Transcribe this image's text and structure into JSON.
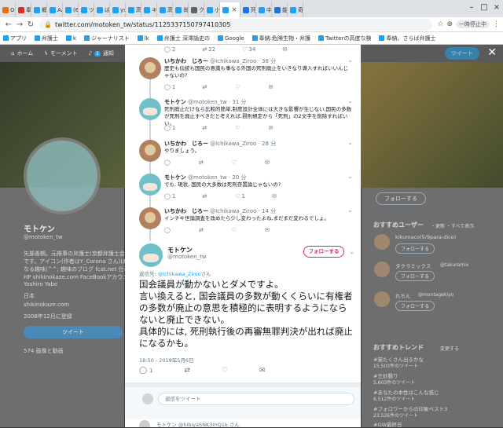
{
  "browser": {
    "tabs": [
      {
        "label": "Or",
        "color": "#e8710a"
      },
      {
        "label": "奉",
        "color": "#d93025"
      },
      {
        "label": "郷",
        "color": "#1da1f2"
      },
      {
        "label": "AA",
        "color": "#1da1f2"
      },
      {
        "label": "(6)",
        "color": "#1da1f2"
      },
      {
        "label": "ツ",
        "color": "#1da1f2"
      },
      {
        "label": "ば",
        "color": "#1da1f2"
      },
      {
        "label": "ys",
        "color": "#1da1f2"
      },
      {
        "label": "高",
        "color": "#1da1f2"
      },
      {
        "label": "キ",
        "color": "#1da1f2"
      },
      {
        "label": "高",
        "color": "#1da1f2"
      },
      {
        "label": "尚",
        "color": "#1da1f2"
      },
      {
        "label": "ク",
        "color": "#5f6368"
      },
      {
        "label": "小",
        "color": "#1da1f2"
      },
      {
        "label": "",
        "color": "#1da1f2",
        "active": true
      },
      {
        "label": "死",
        "color": "#1a73e8"
      },
      {
        "label": "中",
        "color": "#1da1f2"
      },
      {
        "label": "能",
        "color": "#1a73e8"
      },
      {
        "label": "奇",
        "color": "#1da1f2"
      }
    ],
    "window_label": "一時停止中",
    "url": "twitter.com/motoken_tw/status/1125337150797410305",
    "bookmarks": [
      "アプリ",
      "弁護士",
      "k",
      "ジャーナリスト",
      "lk",
      "弁護士 深澤諭史の",
      "Google",
      "奉納:危険生物・弁護",
      "Twitterの高度な検",
      "奉納、さらば弁護士"
    ]
  },
  "twitter_nav": {
    "home": "ホーム",
    "moments": "モーメント",
    "notifications": "通知",
    "notif_count": "1",
    "tweet_button": "ツイート"
  },
  "profile_bg": {
    "name": "モトケン",
    "handle": "@motoken_tw",
    "bio_lines": [
      "矢部善朗。元検事の弁護士(京都弁護士会)",
      "です。アイコン(作者はY_Corona さん)は単",
      "なる趣味(^^; 趣味のブログ fcat.net 仕事用",
      "HP shikinokaze.com FaceBookアカウント",
      "Yoshiro Yabe"
    ],
    "location": "日本",
    "site": "shikinokaze.com",
    "joined": "2008年12月に登録",
    "tweet_button": "ツイート",
    "media_label": "574 画像と動画"
  },
  "right_bg": {
    "follow_label": "フォローする",
    "recommend_title": "おすすめユーザー",
    "recommend_links": "・更新 ・すべて表示",
    "users": [
      {
        "name": "kikumaco(5/9para-dice)"
      },
      {
        "name": "タクラミックス",
        "handle": "@takuramix"
      },
      {
        "name": "れちん",
        "handle": "@montagekiyo"
      }
    ],
    "small_follow": "フォローする",
    "trends_title": "おすすめトレンド",
    "trends_change": "変更する",
    "trends": [
      {
        "tag": "#猫たくさん出るかな",
        "count": "15,503件のツイート"
      },
      {
        "tag": "#王妙腸り",
        "count": "5,603件のツイート"
      },
      {
        "tag": "#あなたの本性はこんな感じ",
        "count": "6,512件のツイート"
      },
      {
        "tag": "#フォロワーからの印象ベスト3",
        "count": "23,526件のツイート"
      },
      {
        "tag": "#GW最終日"
      }
    ]
  },
  "replies": [
    {
      "name": "いちかわ　じろー",
      "handle": "@Ichikawa_Ziroo",
      "time": "38 分",
      "text": "歴史も伝統も国民の意識も事なる外国の死刑廃止をいきなり導入すればいいんじゃないの?",
      "counts": [
        "1",
        "",
        "",
        ""
      ],
      "avatar": "ichikawa"
    },
    {
      "name": "モトケン",
      "handle": "@motoken_tw",
      "time": "31 分",
      "text": "死刑廃止だけなら比較的簡単,制度設計全体には大きな影響が生じない,国民の多数が死刑を廃止すべきだと考えれば,罰則規定から「死刑」の2文字を削除すればいい。",
      "counts": [
        "1",
        "",
        "",
        ""
      ],
      "avatar": "motoken"
    },
    {
      "name": "いちかわ　じろー",
      "handle": "@Ichikawa_Ziroo",
      "time": "28 分",
      "text": "やりましょう。",
      "counts": [
        "",
        "",
        "",
        ""
      ],
      "avatar": "ichikawa"
    },
    {
      "name": "モトケン",
      "handle": "@motoken_tw",
      "time": "20 分",
      "text": "でも, 現状, 国民の大多数は死刑存置論じゃないの?",
      "counts": [
        "1",
        "",
        "1",
        ""
      ],
      "avatar": "motoken"
    },
    {
      "name": "いちかわ　じろー",
      "handle": "@Ichikawa_Ziroo",
      "time": "14 分",
      "text": "インチキ世論調査を改めたら少し変わったよね,まだまだ変わるでしょ。",
      "counts": [
        "",
        "",
        "",
        ""
      ],
      "avatar": "ichikawa"
    }
  ],
  "top_counts": [
    "2",
    "22",
    "34"
  ],
  "main_tweet": {
    "name": "モトケン",
    "handle": "@motoken_tw",
    "follow_label": "フォローする",
    "reply_prefix": "返信先:",
    "reply_to": "@Ichikawa_Ziroo",
    "reply_suffix": "さん",
    "text": "国会議員が動かないとダメですよ。\n言い換えると, 国会議員の多数が動くくらいに有権者の多数が廃止の意思を積極的に表明するようにならないと廃止できない。\n具体的には, 死刑執行後の再審無罪判決が出れば廃止になるかも。",
    "timestamp": "18:50 - 2019年5月6日",
    "reply_count": "1"
  },
  "reply_box": {
    "placeholder": "返信をツイート"
  },
  "next_reply": {
    "text": "モトケン @hibiyaSNK3mQ1k さん"
  }
}
